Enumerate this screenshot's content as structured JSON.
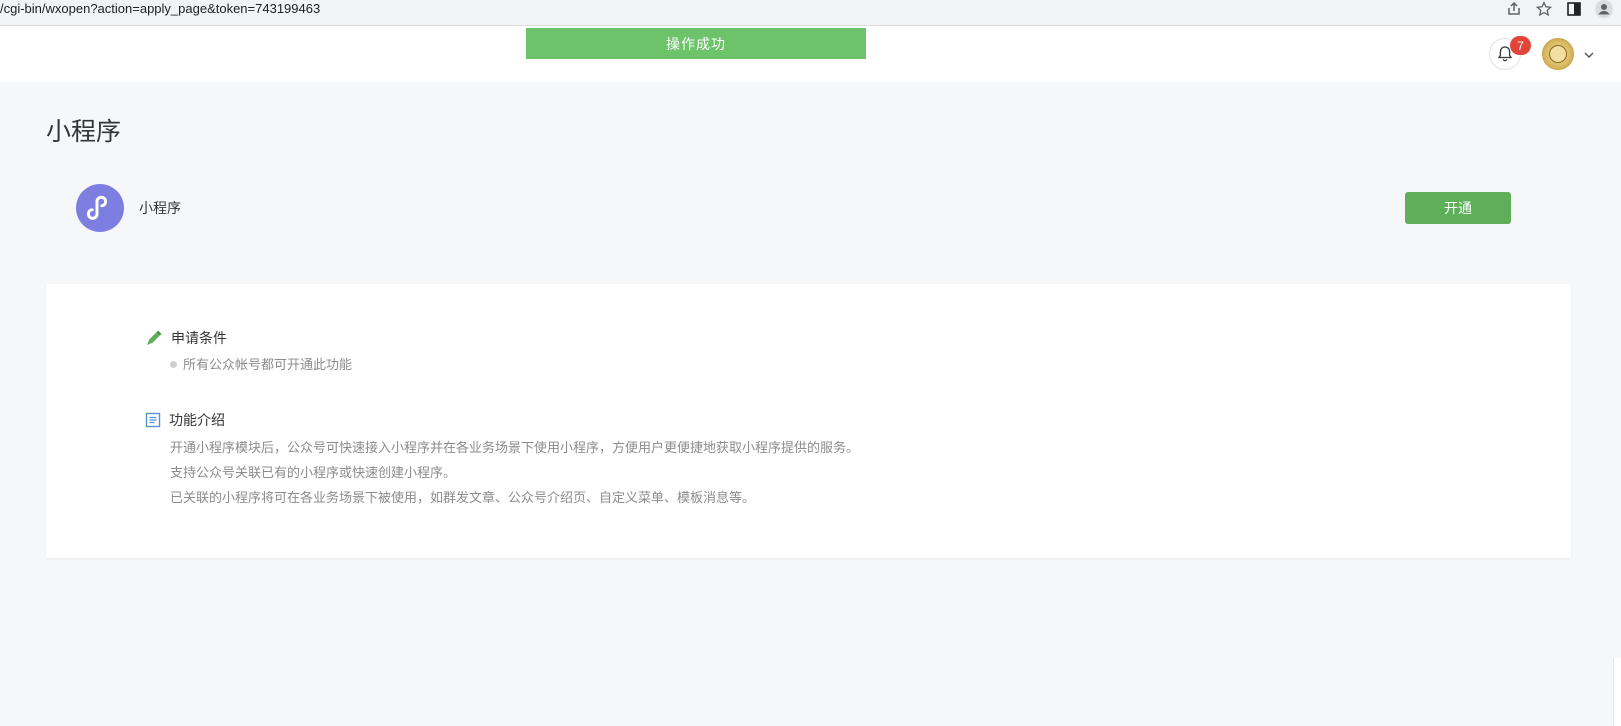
{
  "browser": {
    "url": "/cgi-bin/wxopen?action=apply_page&token=743199463",
    "icons": [
      "share-icon",
      "star-icon",
      "sidepanel-icon",
      "profile-icon"
    ]
  },
  "header": {
    "toast": "操作成功",
    "notification_count": "7",
    "icons": [
      "bell-icon",
      "avatar",
      "chevron-down-icon"
    ]
  },
  "page": {
    "title": "小程序"
  },
  "app": {
    "name": "小程序",
    "open_label": "开通",
    "logo_icon": "mini-program-icon",
    "logo_color": "#7c7fe0"
  },
  "conditions": {
    "title": "申请条件",
    "icon": "pencil-icon",
    "items": [
      "所有公众帐号都可开通此功能"
    ]
  },
  "intro": {
    "title": "功能介绍",
    "icon": "document-icon",
    "lines": [
      "开通小程序模块后，公众号可快速接入小程序并在各业务场景下使用小程序，方便用户更便捷地获取小程序提供的服务。",
      "支持公众号关联已有的小程序或快速创建小程序。",
      "已关联的小程序将可在各业务场景下被使用，如群发文章、公众号介绍页、自定义菜单、模板消息等。"
    ]
  },
  "colors": {
    "toast_bg": "#6cc36a",
    "button_bg": "#5eae5a",
    "badge_bg": "#e2443a",
    "page_bg": "#f6f7f9"
  }
}
